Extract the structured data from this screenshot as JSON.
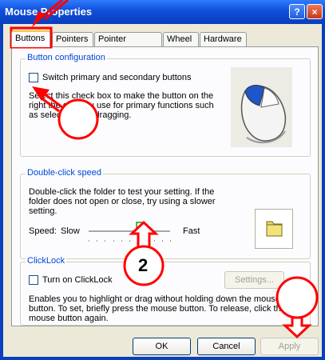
{
  "window": {
    "title": "Mouse Properties",
    "help_label": "?",
    "close_label": "×"
  },
  "tabs": [
    "Buttons",
    "Pointers",
    "Pointer Options",
    "Wheel",
    "Hardware"
  ],
  "button_config": {
    "legend": "Button configuration",
    "switch_label": "Switch primary and secondary buttons",
    "description": [
      "Select this check box to make the button on the",
      "right the one you use for primary functions such",
      "as selecting and dragging."
    ]
  },
  "double_click": {
    "legend": "Double-click speed",
    "description": [
      "Double-click the folder to test your setting. If the",
      "folder does not open or close, try using a slower",
      "setting."
    ],
    "speed_label": "Speed:",
    "slow_label": "Slow",
    "fast_label": "Fast",
    "speed_value": 0.63
  },
  "clicklock": {
    "legend": "ClickLock",
    "turn_on_label": "Turn on ClickLock",
    "settings_label": "Settings...",
    "description": [
      "Enables you to highlight or drag without holding down the mouse",
      "button. To set, briefly press the mouse button. To release, click the",
      "mouse button again."
    ]
  },
  "buttons": {
    "ok": "OK",
    "cancel": "Cancel",
    "apply": "Apply"
  },
  "annotation": {
    "number": "2"
  },
  "colors": {
    "accent": "#0046d5",
    "annotation_red": "#ff0000",
    "title_bar": "#0a3fbd"
  }
}
